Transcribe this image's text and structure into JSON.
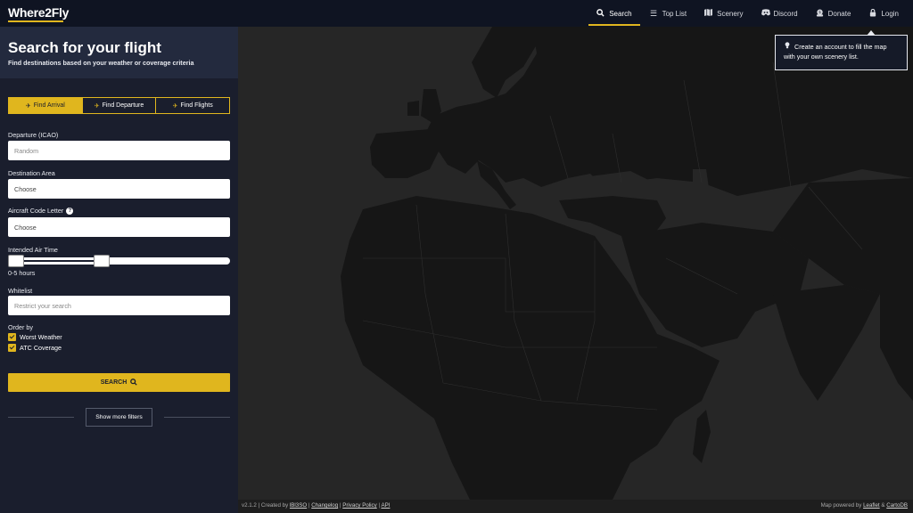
{
  "header": {
    "logo": "Where2Fly",
    "nav": [
      {
        "label": "Search",
        "icon": "search-icon"
      },
      {
        "label": "Top List",
        "icon": "list-icon"
      },
      {
        "label": "Scenery",
        "icon": "map-icon"
      },
      {
        "label": "Discord",
        "icon": "discord-icon"
      },
      {
        "label": "Donate",
        "icon": "donate-icon"
      },
      {
        "label": "Login",
        "icon": "lock-icon"
      }
    ]
  },
  "sidebar": {
    "title": "Search for your flight",
    "subtitle": "Find destinations based on your weather or coverage criteria",
    "tabs": [
      {
        "label": "Find Arrival",
        "icon": "plane-arrival-icon"
      },
      {
        "label": "Find Departure",
        "icon": "plane-departure-icon"
      },
      {
        "label": "Find Flights",
        "icon": "flights-icon"
      }
    ],
    "departure": {
      "label": "Departure (ICAO)",
      "placeholder": "Random"
    },
    "destination": {
      "label": "Destination Area",
      "value": "Choose"
    },
    "aircraft": {
      "label": "Aircraft Code Letter",
      "value": "Choose",
      "help": "?"
    },
    "airtime": {
      "label": "Intended Air Time",
      "value_text": "0-5 hours",
      "range_low": 0,
      "range_high": 5,
      "slider_low_fraction": 0,
      "slider_high_fraction": 0.42
    },
    "whitelist": {
      "label": "Whitelist",
      "placeholder": "Restrict your search"
    },
    "order_by": {
      "label": "Order by",
      "options": [
        {
          "label": "Worst Weather",
          "checked": true
        },
        {
          "label": "ATC Coverage",
          "checked": true
        }
      ]
    },
    "search_button": "SEARCH",
    "more_filters": "Show more filters"
  },
  "tooltip": {
    "text": "Create an account to fill the map with your own scenery list.",
    "icon": "lightbulb-icon"
  },
  "footer": {
    "version": "v2.1.2",
    "created_by_prefix": "| Created by",
    "author": "lBl3SO",
    "changelog": "Changelog",
    "privacy": "Privacy Policy",
    "api": "API",
    "powered_prefix": "Map powered by",
    "leaflet": "Leaflet",
    "and": "&",
    "cartodb": "CartoDB"
  },
  "colors": {
    "accent": "#e0b61e",
    "sidebar": "#1a1e2d",
    "topbar": "#0f1422",
    "map_land": "#161616",
    "map_sea": "#262626"
  }
}
